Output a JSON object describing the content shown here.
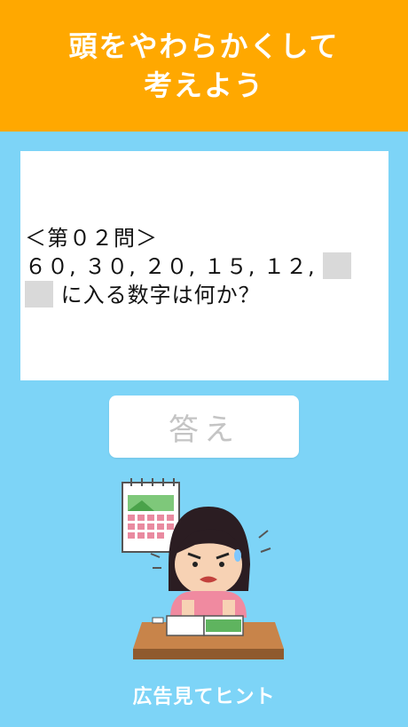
{
  "header": {
    "title_line1": "頭をやわらかくして",
    "title_line2": "考えよう"
  },
  "question": {
    "label": "＜第０２問＞",
    "sequence": "６０, ３０, ２０, １５, １２,",
    "prompt": "に入る数字は何か？"
  },
  "answer_button": {
    "label": "答え"
  },
  "hint_button": {
    "label": "広告見てヒント"
  },
  "colors": {
    "header_bg": "#ffa800",
    "page_bg": "#7dd4f7",
    "button_text": "#c4c4c4"
  },
  "illustration": {
    "icon": "girl-studying-at-desk-illustration"
  }
}
